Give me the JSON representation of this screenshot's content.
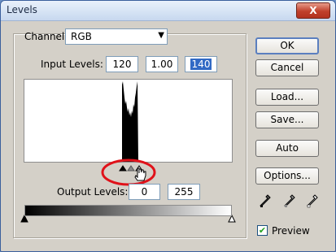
{
  "window": {
    "title": "Levels",
    "close_glyph": "X"
  },
  "channel": {
    "label": "Channel:",
    "value": "RGB"
  },
  "input_levels": {
    "label": "Input Levels:",
    "black": "120",
    "gamma": "1.00",
    "white": "140"
  },
  "output_levels": {
    "label": "Output Levels:",
    "black": "0",
    "white": "255"
  },
  "buttons": {
    "ok": "OK",
    "cancel": "Cancel",
    "load": "Load...",
    "save": "Save...",
    "auto": "Auto",
    "options": "Options..."
  },
  "preview": {
    "label": "Preview",
    "checked": true
  },
  "icons": [
    "black-eyedropper-icon",
    "gray-eyedropper-icon",
    "white-eyedropper-icon",
    "hand-cursor-icon"
  ],
  "colors": {
    "selection": "#316ac5",
    "highlight_circle": "#e0121a",
    "title_close": "#c0402b"
  }
}
